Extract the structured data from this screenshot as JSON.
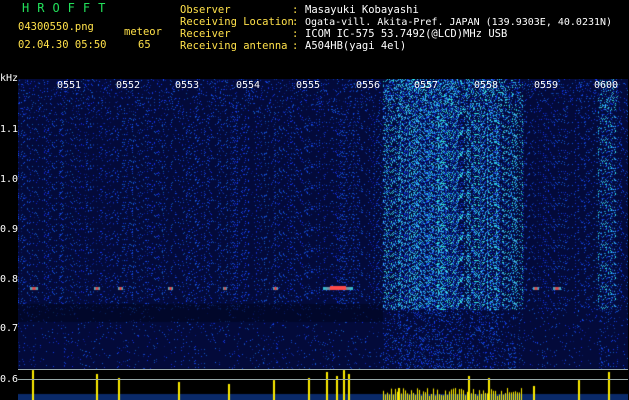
{
  "header": {
    "logo": "HROFFT",
    "filename": "04300550.png",
    "datetime": "02.04.30 05:50",
    "meteor_label": "meteor",
    "meteor_count": "65",
    "info": [
      {
        "label": "Observer",
        "value": "Masayuki Kobayashi"
      },
      {
        "label": "Receiving Location",
        "value": "Ogata-vill. Akita-Pref. JAPAN (139.9303E, 40.0231N)"
      },
      {
        "label": "Receiver",
        "value": "ICOM IC-575 53.7492(@LCD)MHz USB"
      },
      {
        "label": "Receiving antenna",
        "value": "A504HB(yagi 4el)"
      }
    ]
  },
  "axes": {
    "y_unit": "kHz",
    "y_ticks": [
      "1.1",
      "1.0",
      "0.9",
      "0.8",
      "0.7",
      "0.6"
    ],
    "x_ticks": [
      "0551",
      "0552",
      "0553",
      "0554",
      "0555",
      "0556",
      "0557",
      "0558",
      "0559",
      "0600"
    ]
  },
  "colors": {
    "background": "#000000",
    "spectrogram_base": "#030a3a",
    "noise_blue": "#1a3fd8",
    "noise_cyan": "#22c8e0",
    "echo_red": "#ff3030",
    "count_yellow": "#ffee00",
    "header_green": "#22e05a",
    "header_yellow": "#ffe14a"
  }
}
